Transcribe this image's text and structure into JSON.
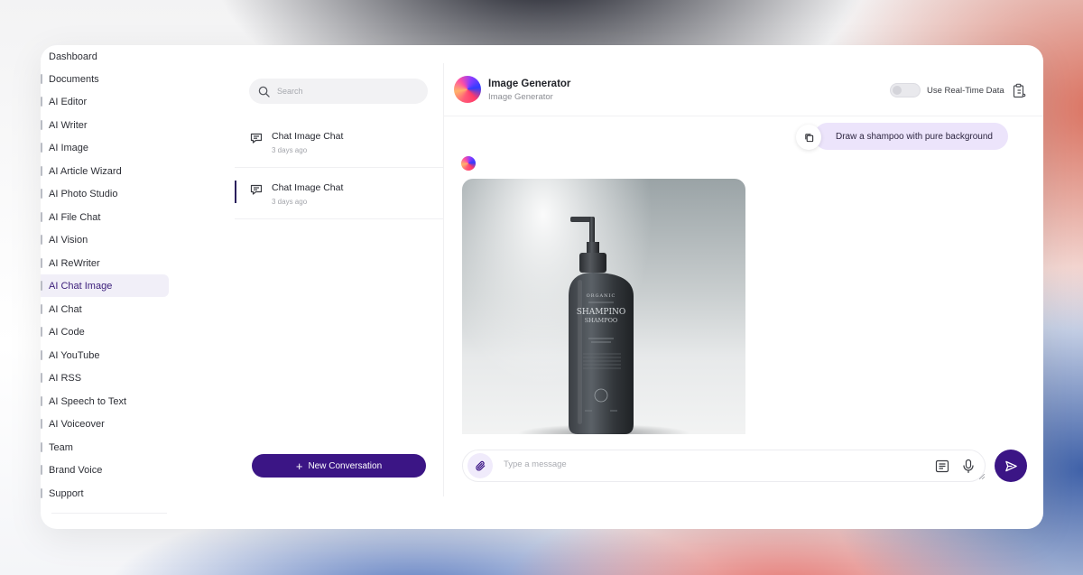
{
  "sidebar": {
    "items": [
      {
        "label": "Dashboard"
      },
      {
        "label": "Documents"
      },
      {
        "label": "AI Editor"
      },
      {
        "label": "AI Writer"
      },
      {
        "label": "AI Image"
      },
      {
        "label": "AI Article Wizard"
      },
      {
        "label": "AI Photo Studio"
      },
      {
        "label": "AI File Chat"
      },
      {
        "label": "AI Vision"
      },
      {
        "label": "AI ReWriter"
      },
      {
        "label": "AI Chat Image",
        "active": true
      },
      {
        "label": "AI Chat"
      },
      {
        "label": "AI Code"
      },
      {
        "label": "AI YouTube"
      },
      {
        "label": "AI RSS"
      },
      {
        "label": "AI Speech to Text"
      },
      {
        "label": "AI Voiceover"
      },
      {
        "label": "Team"
      },
      {
        "label": "Brand Voice"
      },
      {
        "label": "Support"
      }
    ]
  },
  "conversations": {
    "search_placeholder": "Search",
    "items": [
      {
        "title": "Chat Image Chat",
        "time": "3 days ago"
      },
      {
        "title": "Chat Image Chat",
        "time": "3 days ago",
        "selected": true
      }
    ],
    "new_button": "New Conversation"
  },
  "chat": {
    "title": "Image Generator",
    "subtitle": "Image Generator",
    "realtime_label": "Use Real-Time Data",
    "realtime_enabled": false,
    "user_message": "Draw a shampoo with pure background",
    "composer_placeholder": "Type a message",
    "image_text": {
      "brand": "ORGANIC",
      "name": "SHAMPINO",
      "type": "SHAMPOO"
    }
  },
  "icons": {
    "search": "search-icon",
    "conversation": "chat-bubble-icon",
    "copy": "copy-icon",
    "clipboard": "clipboard-icon",
    "attach": "paperclip-icon",
    "prompt": "prompt-list-icon",
    "mic": "microphone-icon",
    "send": "send-icon"
  },
  "colors": {
    "accent": "#3b1585",
    "bubble": "#ece4fb",
    "active_nav": "#f1eff8"
  }
}
